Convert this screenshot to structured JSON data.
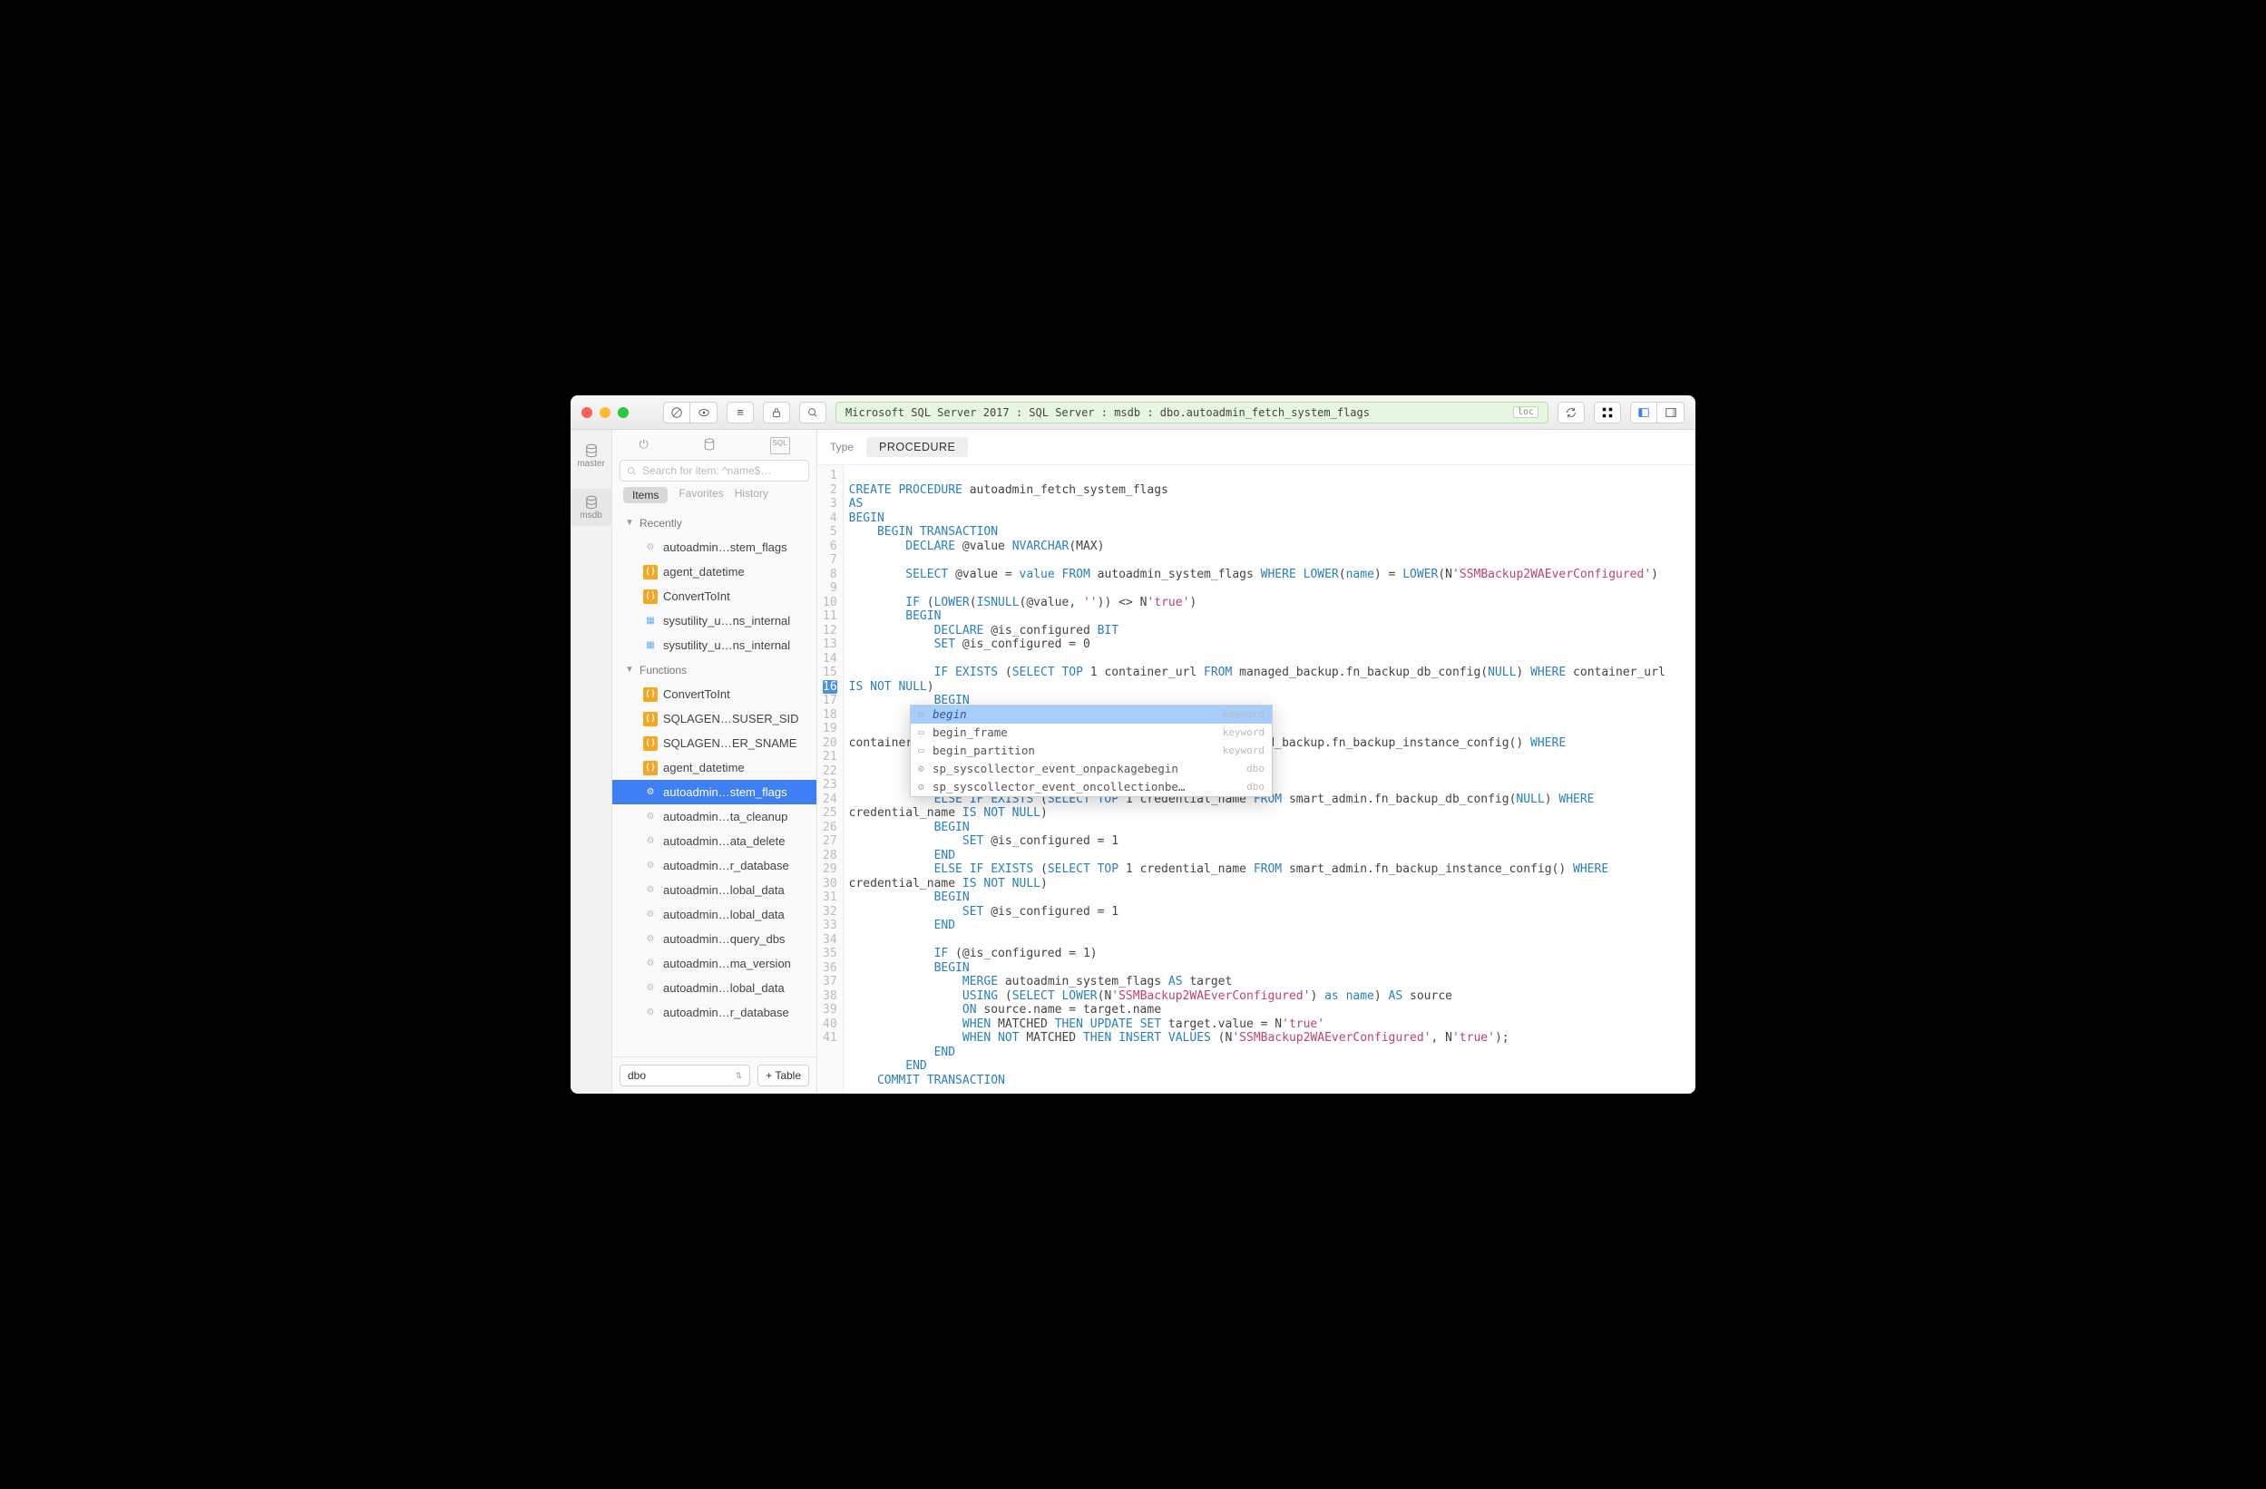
{
  "titlebar": {
    "breadcrumb": "Microsoft SQL Server 2017 : SQL Server : msdb : dbo.autoadmin_fetch_system_flags",
    "loc_badge": "loc"
  },
  "rail": {
    "items": [
      {
        "label": "master"
      },
      {
        "label": "msdb"
      }
    ]
  },
  "sidebar": {
    "search_placeholder": "Search for item: ^name$…",
    "tabs": {
      "items": "Items",
      "favorites": "Favorites",
      "history": "History"
    },
    "sections": [
      {
        "title": "Recently",
        "items": [
          {
            "icon": "gear",
            "label": "autoadmin…stem_flags"
          },
          {
            "icon": "fx",
            "label": "agent_datetime"
          },
          {
            "icon": "fx",
            "label": "ConvertToInt"
          },
          {
            "icon": "table",
            "label": "sysutility_u…ns_internal"
          },
          {
            "icon": "table",
            "label": "sysutility_u…ns_internal"
          }
        ]
      },
      {
        "title": "Functions",
        "items": [
          {
            "icon": "fx",
            "label": "ConvertToInt"
          },
          {
            "icon": "fx",
            "label": "SQLAGEN…SUSER_SID"
          },
          {
            "icon": "fx",
            "label": "SQLAGEN…ER_SNAME"
          },
          {
            "icon": "fx",
            "label": "agent_datetime"
          },
          {
            "icon": "gear",
            "label": "autoadmin…stem_flags",
            "selected": true
          },
          {
            "icon": "gear",
            "label": "autoadmin…ta_cleanup"
          },
          {
            "icon": "gear",
            "label": "autoadmin…ata_delete"
          },
          {
            "icon": "gear",
            "label": "autoadmin…r_database"
          },
          {
            "icon": "gear",
            "label": "autoadmin…lobal_data"
          },
          {
            "icon": "gear",
            "label": "autoadmin…lobal_data"
          },
          {
            "icon": "gear",
            "label": "autoadmin…query_dbs"
          },
          {
            "icon": "gear",
            "label": "autoadmin…ma_version"
          },
          {
            "icon": "gear",
            "label": "autoadmin…lobal_data"
          },
          {
            "icon": "gear",
            "label": "autoadmin…r_database"
          }
        ]
      }
    ],
    "schema_select": "dbo",
    "add_table_button": "+ Table"
  },
  "editor": {
    "type_label": "Type",
    "type_value": "PROCEDURE",
    "current_line": 16,
    "line_count": 41
  },
  "autocomplete": {
    "items": [
      {
        "name": "begin",
        "kind": "keyword",
        "selected": true
      },
      {
        "name": "begin_frame",
        "kind": "keyword"
      },
      {
        "name": "begin_partition",
        "kind": "keyword"
      },
      {
        "name": "sp_syscollector_event_onpackagebegin",
        "kind": "dbo"
      },
      {
        "name": "sp_syscollector_event_oncollectionbe…",
        "kind": "dbo"
      }
    ]
  },
  "chart_data": null
}
